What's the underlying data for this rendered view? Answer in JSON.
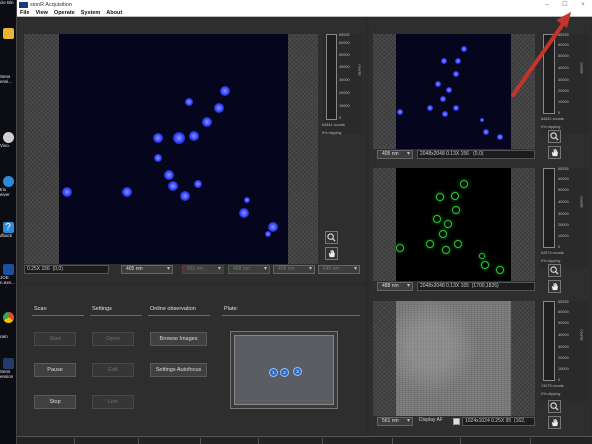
{
  "window": {
    "title": "sionR Acquisition",
    "controls": [
      "minimize-icon",
      "maximize-icon",
      "close-icon"
    ]
  },
  "menu": [
    "File",
    "View",
    "Operate",
    "System",
    "About"
  ],
  "desktop_icons": [
    {
      "label": "cle Bin",
      "color": "#8fb0c8"
    },
    {
      "label": "",
      "color": "#e8b530"
    },
    {
      "label": "Sens",
      "color": "#3a78d0"
    },
    {
      "label": "ensi...",
      "color": "#3a78d0"
    },
    {
      "label": "Vivo.",
      "color": "#d0d0d0"
    },
    {
      "label": "trix",
      "color": "#2f8ad8"
    },
    {
      "label": "eiver",
      "color": "#2f8ad8"
    },
    {
      "label": "dback",
      "color": "#2f8ad8"
    },
    {
      "label": "JOE",
      "color": "#1b4fa0"
    },
    {
      "label": "n.exe...",
      "color": "#1b4fa0"
    },
    {
      "label": "",
      "color": "#e34a35"
    },
    {
      "label": "ram",
      "color": "#e34a35"
    },
    {
      "label": "Sens",
      "color": "#243a6a"
    },
    {
      "label": "ension",
      "color": "#243a6a"
    }
  ],
  "main_view": {
    "zoom_label": "0.25X 156",
    "coords": "(0,0)",
    "channel": "405 nm",
    "channels_dim": [
      "561 nm",
      "488 nm",
      "405 nm",
      "640 nm"
    ],
    "scale_ticks": [
      "65535",
      "60000",
      "50000",
      "40000",
      "30000",
      "20000",
      "10000",
      "0"
    ],
    "scale_unit": "counts",
    "counts": "64841",
    "counts_unit": "counts",
    "clipping": "0% clipping"
  },
  "small_views": [
    {
      "channel": "405 nm",
      "info": "2048x2048 0.13X 156",
      "coords": "(0,0)",
      "scale_ticks": [
        "65535",
        "60000",
        "50000",
        "40000",
        "30000",
        "20000",
        "10000",
        "0"
      ],
      "scale_unit": "counts",
      "counts": "64841",
      "counts_unit": "counts",
      "clipping": "0% clipping"
    },
    {
      "channel": "488 nm",
      "info": "2048x2048 0.13X 165",
      "coords": "(1700,1826)",
      "scale_ticks": [
        "65535",
        "60000",
        "50000",
        "40000",
        "30000",
        "20000",
        "10000",
        "0"
      ],
      "scale_unit": "counts",
      "counts": "62674",
      "counts_unit": "counts",
      "clipping": "0% clipping"
    },
    {
      "channel": "561 nm",
      "info": "1024x1024 0.25X 95",
      "coords": "(162,",
      "display_af": "Display AF",
      "scale_ticks": [
        "65535",
        "60000",
        "50000",
        "40000",
        "30000",
        "20000",
        "10000",
        "0"
      ],
      "scale_unit": "counts",
      "counts": "13075",
      "counts_unit": "counts",
      "clipping": "0% clipping"
    }
  ],
  "controls": {
    "scan_label": "Scan",
    "settings_label": "Settings",
    "online_label": "Online observation",
    "plate_label": "Plate:",
    "start": "Start",
    "pause": "Pause",
    "stop": "Stop",
    "open": "Open",
    "edit": "Edit",
    "live": "Live",
    "browse": "Browse Images",
    "autofocus": "Settings Autofocus",
    "wells": [
      "1",
      "2",
      "3"
    ]
  },
  "colors": {
    "nuclei": "#2f3cff",
    "gfp": "#1fd42a",
    "annotation_arrow": "#c4342d"
  }
}
